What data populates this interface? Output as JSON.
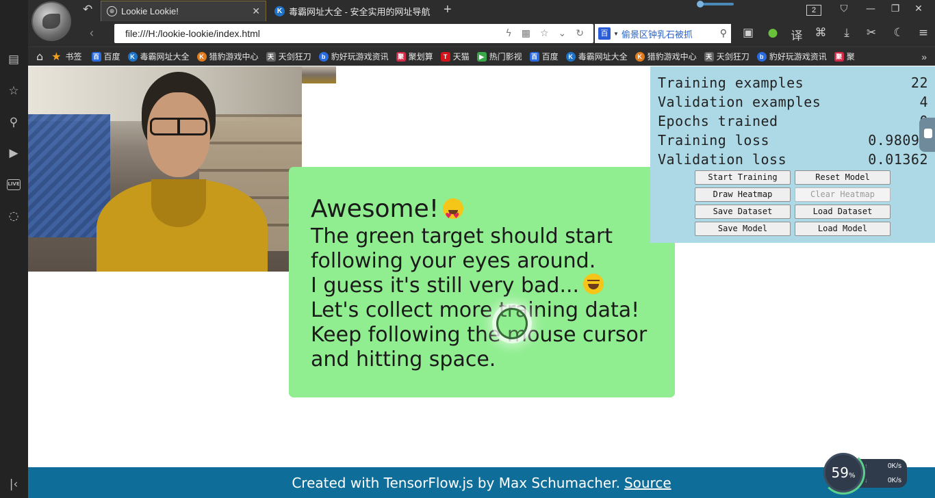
{
  "browser": {
    "tabs": [
      {
        "title": "Lookie Lookie!",
        "icon": "globe-icon",
        "active": true
      },
      {
        "title": "毒霸网址大全 - 安全实用的网址导航",
        "icon": "k-logo-icon",
        "active": false
      }
    ],
    "tab_count": "2",
    "address": "file:///H:/lookie-lookie/index.html",
    "search_text": "偷景区钟乳石被抓",
    "search_engine_label": "百",
    "bookmarks_label": "书签",
    "bookmarks": [
      "百度",
      "毒霸网址大全",
      "猎豹游戏中心",
      "天剑狂刀",
      "豹好玩游戏资讯",
      "聚划算",
      "天猫",
      "热门影视",
      "百度",
      "毒霸网址大全",
      "猎豹游戏中心",
      "天剑狂刀",
      "豹好玩游戏资讯",
      "聚"
    ]
  },
  "message": {
    "title": "Awesome!",
    "lines": [
      "The green target should start",
      "following your eyes around.",
      "I guess it's still very bad...",
      "Let's collect more training data!",
      "Keep following the mouse cursor",
      "and hitting space."
    ]
  },
  "stats": {
    "training_examples_label": "Training examples",
    "training_examples": "22",
    "validation_examples_label": "Validation examples",
    "validation_examples": "4",
    "epochs_trained_label": "Epochs trained",
    "epochs_trained": "0",
    "training_loss_label": "Training loss",
    "training_loss": "0.98091",
    "validation_loss_label": "Validation loss",
    "validation_loss": "0.01362"
  },
  "buttons": {
    "start_training": "Start Training",
    "reset_model": "Reset Model",
    "draw_heatmap": "Draw Heatmap",
    "clear_heatmap": "Clear Heatmap",
    "save_dataset": "Save Dataset",
    "load_dataset": "Load Dataset",
    "save_model": "Save Model",
    "load_model": "Load Model"
  },
  "footer": {
    "text": "Created with TensorFlow.js by Max Schumacher.",
    "link": "Source"
  },
  "net_widget": {
    "cpu_percent": "59",
    "percent_sign": "%",
    "upload": "0K/s",
    "download": "0K/s"
  },
  "colors": {
    "message_bg": "#90ee90",
    "stats_bg": "#add8e6",
    "footer_bg": "#0f6e99"
  }
}
